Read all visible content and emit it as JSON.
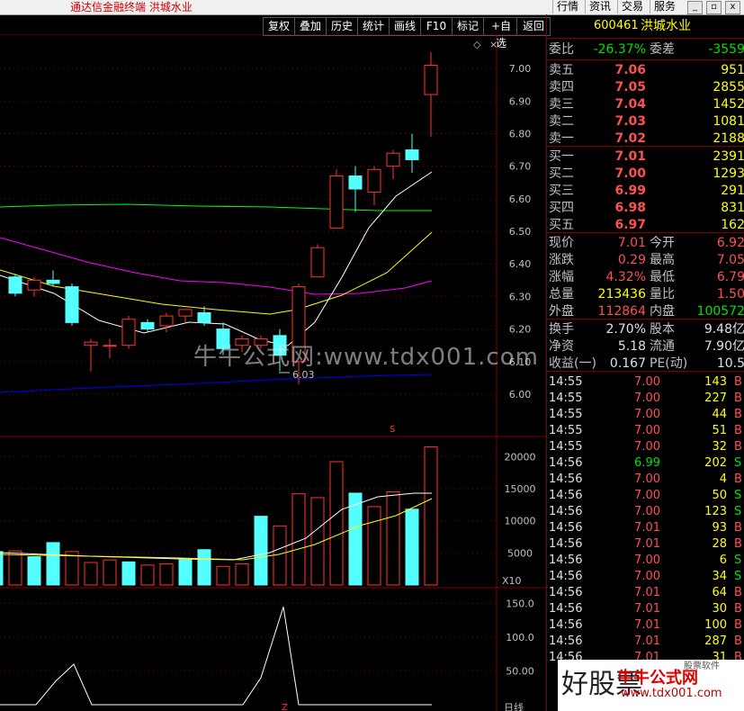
{
  "window": {
    "title": "通达信金融终端  洪城水业",
    "menus": [
      "行情",
      "资讯",
      "交易",
      "服务"
    ],
    "controls": [
      "_",
      "▫",
      "x"
    ]
  },
  "toolbar": [
    "复权",
    "叠加",
    "历史",
    "统计",
    "画线",
    "F10",
    "标记",
    "+自选",
    "返回"
  ],
  "chart": {
    "price_ticks": [
      "7.00",
      "6.90",
      "6.80",
      "6.70",
      "6.60",
      "6.50",
      "6.40",
      "6.30",
      "6.20",
      "6.10",
      "6.00"
    ],
    "low_label": "6.03",
    "volume_ticks": [
      "20000",
      "15000",
      "10000",
      "5000"
    ],
    "volume_unit": "X10",
    "indicator_ticks": [
      "150.0",
      "100.0",
      "50.00"
    ],
    "bottom_label": "日线",
    "marker_s": "S",
    "bottom_marker": "Z"
  },
  "chart_data": {
    "type": "candlestick",
    "ylim": [
      6.0,
      7.05
    ],
    "candles": [
      {
        "o": 6.31,
        "c": 6.36,
        "h": 6.37,
        "l": 6.3,
        "up": false
      },
      {
        "o": 6.32,
        "c": 6.35,
        "h": 6.36,
        "l": 6.3,
        "up": true
      },
      {
        "o": 6.34,
        "c": 6.35,
        "h": 6.38,
        "l": 6.33,
        "up": false
      },
      {
        "o": 6.33,
        "c": 6.22,
        "h": 6.34,
        "l": 6.21,
        "up": false
      },
      {
        "o": 6.16,
        "c": 6.15,
        "h": 6.17,
        "l": 6.07,
        "up": true
      },
      {
        "o": 6.15,
        "c": 6.15,
        "h": 6.17,
        "l": 6.11,
        "up": true
      },
      {
        "o": 6.15,
        "c": 6.23,
        "h": 6.24,
        "l": 6.14,
        "up": true
      },
      {
        "o": 6.2,
        "c": 6.22,
        "h": 6.23,
        "l": 6.19,
        "up": false
      },
      {
        "o": 6.21,
        "c": 6.24,
        "h": 6.25,
        "l": 6.19,
        "up": true
      },
      {
        "o": 6.24,
        "c": 6.26,
        "h": 6.26,
        "l": 6.22,
        "up": true
      },
      {
        "o": 6.22,
        "c": 6.25,
        "h": 6.27,
        "l": 6.21,
        "up": false
      },
      {
        "o": 6.2,
        "c": 6.14,
        "h": 6.22,
        "l": 6.12,
        "up": false
      },
      {
        "o": 6.15,
        "c": 6.17,
        "h": 6.18,
        "l": 6.13,
        "up": true
      },
      {
        "o": 6.15,
        "c": 6.17,
        "h": 6.18,
        "l": 6.14,
        "up": true
      },
      {
        "o": 6.18,
        "c": 6.12,
        "h": 6.2,
        "l": 6.07,
        "up": false
      },
      {
        "o": 6.1,
        "c": 6.33,
        "h": 6.34,
        "l": 6.03,
        "up": true
      },
      {
        "o": 6.36,
        "c": 6.45,
        "h": 6.46,
        "l": 6.36,
        "up": true
      },
      {
        "o": 6.51,
        "c": 6.67,
        "h": 6.69,
        "l": 6.51,
        "up": true
      },
      {
        "o": 6.67,
        "c": 6.63,
        "h": 6.7,
        "l": 6.56,
        "up": false
      },
      {
        "o": 6.62,
        "c": 6.69,
        "h": 6.7,
        "l": 6.58,
        "up": true
      },
      {
        "o": 6.7,
        "c": 6.74,
        "h": 6.75,
        "l": 6.66,
        "up": true
      },
      {
        "o": 6.75,
        "c": 6.72,
        "h": 6.8,
        "l": 6.68,
        "up": false
      },
      {
        "o": 6.92,
        "c": 7.01,
        "h": 7.05,
        "l": 6.79,
        "up": true
      }
    ],
    "volumes": [
      {
        "v": 5200,
        "up": false
      },
      {
        "v": 5300,
        "up": true
      },
      {
        "v": 4400,
        "up": false
      },
      {
        "v": 6600,
        "up": false
      },
      {
        "v": 5200,
        "up": true
      },
      {
        "v": 3500,
        "up": true
      },
      {
        "v": 3900,
        "up": true
      },
      {
        "v": 3600,
        "up": false
      },
      {
        "v": 3100,
        "up": true
      },
      {
        "v": 3300,
        "up": true
      },
      {
        "v": 3900,
        "up": false
      },
      {
        "v": 5500,
        "up": false
      },
      {
        "v": 2900,
        "up": true
      },
      {
        "v": 3300,
        "up": true
      },
      {
        "v": 10700,
        "up": false
      },
      {
        "v": 9200,
        "up": true
      },
      {
        "v": 14200,
        "up": true
      },
      {
        "v": 13600,
        "up": true
      },
      {
        "v": 19200,
        "up": true
      },
      {
        "v": 14300,
        "up": false
      },
      {
        "v": 12200,
        "up": true
      },
      {
        "v": 14500,
        "up": true
      },
      {
        "v": 11800,
        "up": false
      },
      {
        "v": 21500,
        "up": true
      }
    ],
    "vol_ylim": [
      0,
      22000
    ],
    "indicator": [
      0,
      0,
      0,
      0,
      0,
      38,
      60,
      0,
      0,
      0,
      0,
      0,
      0,
      0,
      0,
      0,
      0,
      0,
      0,
      0,
      0,
      0,
      0,
      0,
      0,
      0,
      0,
      0,
      0,
      0,
      0,
      0,
      0,
      0,
      0,
      0,
      0,
      0,
      0,
      0,
      0,
      0,
      0,
      0,
      0,
      0,
      0,
      0,
      0,
      0,
      0,
      0,
      0,
      0,
      0,
      0,
      0,
      0,
      0,
      0,
      100,
      145,
      0,
      0,
      0,
      0,
      0,
      0,
      0,
      0,
      0,
      0,
      0,
      0,
      0,
      0,
      0,
      0
    ],
    "ind_ylim": [
      0,
      160
    ]
  },
  "quote": {
    "code": "600461",
    "name": "洪城水业",
    "weibi_label": "委比",
    "weibi": "-26.37%",
    "weicha_label": "委差",
    "weicha": "-3559",
    "asks": [
      {
        "label": "卖五",
        "price": "7.06",
        "vol": "951"
      },
      {
        "label": "卖四",
        "price": "7.05",
        "vol": "2855"
      },
      {
        "label": "卖三",
        "price": "7.04",
        "vol": "1452"
      },
      {
        "label": "卖二",
        "price": "7.03",
        "vol": "1081"
      },
      {
        "label": "卖一",
        "price": "7.02",
        "vol": "2188"
      }
    ],
    "bids": [
      {
        "label": "买一",
        "price": "7.01",
        "vol": "2391"
      },
      {
        "label": "买二",
        "price": "7.00",
        "vol": "1293"
      },
      {
        "label": "买三",
        "price": "6.99",
        "vol": "291"
      },
      {
        "label": "买四",
        "price": "6.98",
        "vol": "831"
      },
      {
        "label": "买五",
        "price": "6.97",
        "vol": "162"
      }
    ],
    "stats": [
      {
        "l1": "现价",
        "v1": "7.01",
        "c1": "red",
        "l2": "今开",
        "v2": "6.92",
        "c2": "red"
      },
      {
        "l1": "涨跌",
        "v1": "0.29",
        "c1": "red",
        "l2": "最高",
        "v2": "7.05",
        "c2": "red"
      },
      {
        "l1": "涨幅",
        "v1": "4.32%",
        "c1": "red",
        "l2": "最低",
        "v2": "6.79",
        "c2": "red"
      },
      {
        "l1": "总量",
        "v1": "213436",
        "c1": "yellow",
        "l2": "量比",
        "v2": "1.50",
        "c2": "red"
      },
      {
        "l1": "外盘",
        "v1": "112864",
        "c1": "red",
        "l2": "内盘",
        "v2": "100572",
        "c2": "green"
      }
    ],
    "stats2": [
      {
        "l1": "换手",
        "v1": "2.70%",
        "c1": "white",
        "l2": "股本",
        "v2": "9.48亿",
        "c2": "white"
      },
      {
        "l1": "净资",
        "v1": "5.18",
        "c1": "white",
        "l2": "流通",
        "v2": "7.90亿",
        "c2": "white"
      },
      {
        "l1": "收益(一)",
        "v1": "0.167",
        "c1": "white",
        "l2": "PE(动)",
        "v2": "10.5",
        "c2": "white"
      }
    ]
  },
  "ticks": [
    {
      "t": "14:55",
      "p": "7.00",
      "v": "143",
      "bs": "B"
    },
    {
      "t": "14:55",
      "p": "7.00",
      "v": "227",
      "bs": "B"
    },
    {
      "t": "14:55",
      "p": "7.00",
      "v": "44",
      "bs": "B"
    },
    {
      "t": "14:55",
      "p": "7.00",
      "v": "51",
      "bs": "B"
    },
    {
      "t": "14:55",
      "p": "7.00",
      "v": "32",
      "bs": "B"
    },
    {
      "t": "14:56",
      "p": "6.99",
      "v": "202",
      "bs": "S"
    },
    {
      "t": "14:56",
      "p": "7.00",
      "v": "4",
      "bs": "B"
    },
    {
      "t": "14:56",
      "p": "7.00",
      "v": "50",
      "bs": "S"
    },
    {
      "t": "14:56",
      "p": "7.00",
      "v": "123",
      "bs": "S"
    },
    {
      "t": "14:56",
      "p": "7.01",
      "v": "93",
      "bs": "B"
    },
    {
      "t": "14:56",
      "p": "7.01",
      "v": "28",
      "bs": "B"
    },
    {
      "t": "14:56",
      "p": "7.00",
      "v": "6",
      "bs": "S"
    },
    {
      "t": "14:56",
      "p": "7.00",
      "v": "34",
      "bs": "S"
    },
    {
      "t": "14:56",
      "p": "7.01",
      "v": "64",
      "bs": "B"
    },
    {
      "t": "14:56",
      "p": "7.01",
      "v": "30",
      "bs": "B"
    },
    {
      "t": "14:56",
      "p": "7.01",
      "v": "100",
      "bs": "B"
    },
    {
      "t": "14:56",
      "p": "7.01",
      "v": "287",
      "bs": "B"
    },
    {
      "t": "14:56",
      "p": "7.01",
      "v": "31",
      "bs": "B"
    }
  ],
  "watermark": "牛牛公式网:www.tdx001.com",
  "logo": {
    "line1": "牛牛公式网",
    "line2": "www.tdx001.com",
    "left_text": "好股票",
    "tag": "股票软件"
  },
  "colors": {
    "up": "#ff3232",
    "down": "#54ffff",
    "ma5": "#ffffff",
    "ma10": "#ffff00",
    "ma20": "#ff00ff",
    "ma60": "#00ff00",
    "ma120": "#0000ff"
  }
}
